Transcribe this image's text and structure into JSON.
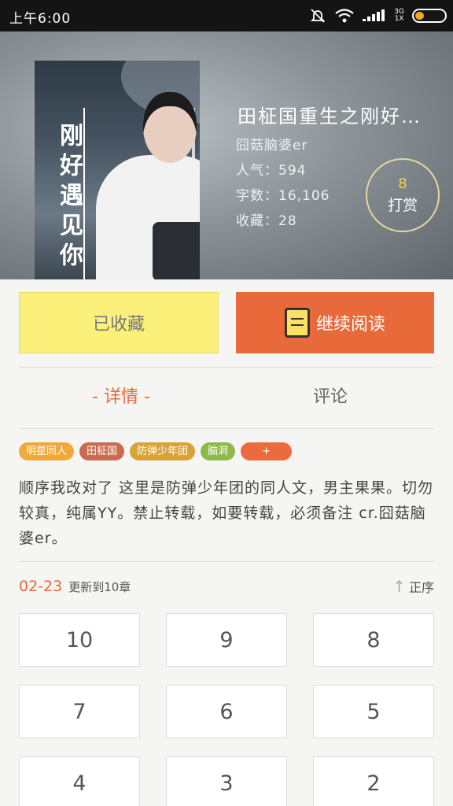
{
  "status_bar": {
    "time": "上午6:00",
    "network_top": "3G",
    "network_bottom": "1X"
  },
  "book": {
    "cover_text": "刚好遇见你",
    "title": "田柾国重生之刚好…",
    "author": "囧菇脑婆er",
    "popularity": "人气：594",
    "word_count": "字数：16,106",
    "favorites": "收藏：28",
    "reward_count": "8",
    "reward_label": "打赏"
  },
  "actions": {
    "favorited_label": "已收藏",
    "continue_label": "继续阅读"
  },
  "tabs": [
    {
      "label": "- 详情 -",
      "active": true
    },
    {
      "label": "评论",
      "active": false
    }
  ],
  "tags": [
    {
      "label": "明星同人",
      "color": "#f2a93b"
    },
    {
      "label": "田柾国",
      "color": "#c86b50"
    },
    {
      "label": "防弹少年团",
      "color": "#d9a234"
    },
    {
      "label": "脑洞",
      "color": "#8fba4a"
    },
    {
      "label": "+",
      "color": "#ec6b3c"
    }
  ],
  "description": "顺序我改对了          这里是防弹少年团的同人文，男主果果。切勿较真，纯属YY。禁止转载，如要转载，必须备注  cr.囧菇脑婆er。",
  "update": {
    "date": "02-23",
    "info": "更新到10章",
    "order_label": "正序"
  },
  "chapters": [
    "10",
    "9",
    "8",
    "7",
    "6",
    "5",
    "4",
    "3",
    "2"
  ]
}
